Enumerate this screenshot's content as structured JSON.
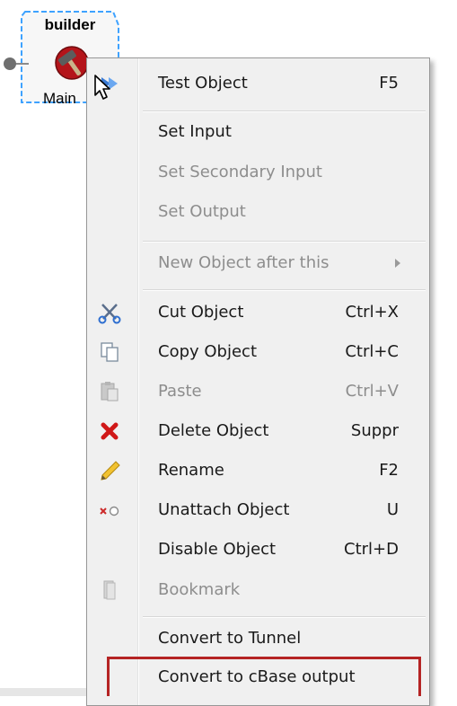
{
  "node": {
    "title": "builder",
    "label": "Main",
    "colors": {
      "border": "#3ea2ff",
      "fill": "#f7f7f7",
      "icon_red": "#b4141a"
    }
  },
  "menu": {
    "items": [
      {
        "label": "Test Object",
        "shortcut": "F5",
        "enabled": true,
        "icon": "test-arrow-icon"
      },
      {
        "label": "Set Input",
        "shortcut": "",
        "enabled": true,
        "icon": ""
      },
      {
        "label": "Set Secondary Input",
        "shortcut": "",
        "enabled": false,
        "icon": ""
      },
      {
        "label": "Set Output",
        "shortcut": "",
        "enabled": false,
        "icon": ""
      },
      {
        "label": "New Object after this",
        "shortcut": "",
        "enabled": false,
        "icon": "",
        "submenu": true
      },
      {
        "label": "Cut Object",
        "shortcut": "Ctrl+X",
        "enabled": true,
        "icon": "scissors-icon"
      },
      {
        "label": "Copy Object",
        "shortcut": "Ctrl+C",
        "enabled": true,
        "icon": "copy-icon"
      },
      {
        "label": "Paste",
        "shortcut": "Ctrl+V",
        "enabled": false,
        "icon": "paste-icon"
      },
      {
        "label": "Delete Object",
        "shortcut": "Suppr",
        "enabled": true,
        "icon": "delete-x-icon"
      },
      {
        "label": "Rename",
        "shortcut": "F2",
        "enabled": true,
        "icon": "pencil-icon"
      },
      {
        "label": "Unattach Object",
        "shortcut": "U",
        "enabled": true,
        "icon": "unattach-icon"
      },
      {
        "label": "Disable Object",
        "shortcut": "Ctrl+D",
        "enabled": true,
        "icon": ""
      },
      {
        "label": "Bookmark",
        "shortcut": "",
        "enabled": false,
        "icon": "bookmark-icon"
      },
      {
        "label": "Convert to Tunnel",
        "shortcut": "",
        "enabled": true,
        "icon": ""
      },
      {
        "label": "Convert to cBase output",
        "shortcut": "",
        "enabled": true,
        "icon": "",
        "highlighted": true
      }
    ],
    "colors": {
      "background": "#f0f0f0",
      "disabled_text": "#8d8d8d",
      "highlight_border": "#b52424"
    }
  }
}
